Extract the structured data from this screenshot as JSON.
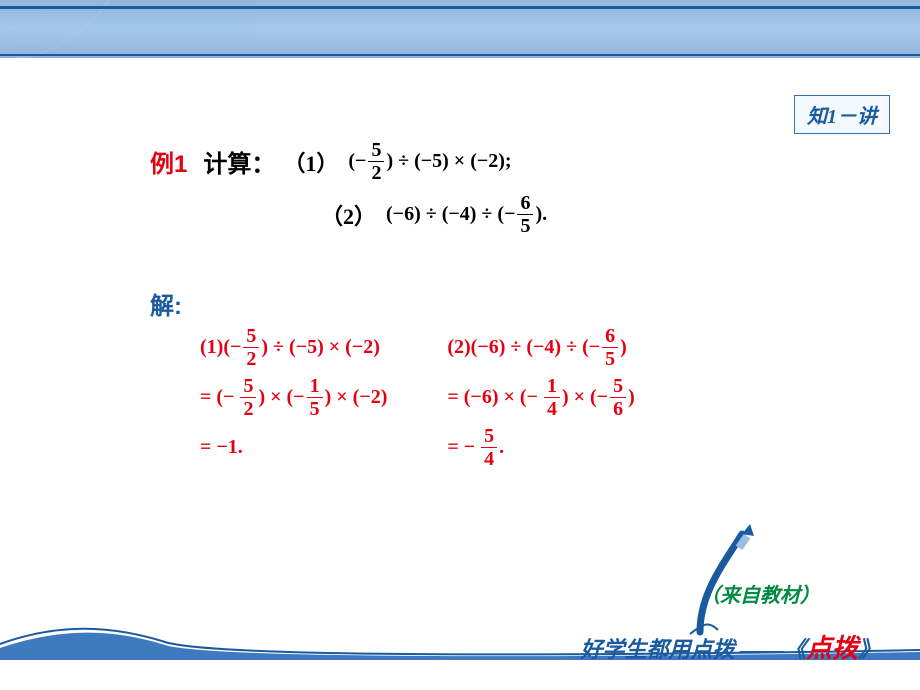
{
  "badge": "知1－讲",
  "example_label": "例1",
  "calc_label": "计算：",
  "item1_label": "（1）",
  "item2_label": "（2）",
  "solution_label": "解:",
  "source": "（来自教材）",
  "tagline_blue": "好学生都用点拨 ——《",
  "tagline_red": "点拨",
  "tagline_close": "》",
  "prob1": {
    "p1": "(−",
    "p2": "5",
    "p3": "2",
    "p4": ") ÷ (−5) × (−2);"
  },
  "prob2": {
    "p1": "(−6) ÷ (−4) ÷ (−",
    "p2": "6",
    "p3": "5",
    "p4": ")."
  },
  "sol1": {
    "l1a": "(1)(−",
    "l1n": "5",
    "l1d": "2",
    "l1b": ") ÷ (−5) × (−2)",
    "l2a": "= (−",
    "l2n1": "5",
    "l2d1": "2",
    "l2b": ") × (−",
    "l2n2": "1",
    "l2d2": "5",
    "l2c": ") × (−2)",
    "l3": "= −1."
  },
  "sol2": {
    "l1a": "(2)(−6) ÷ (−4) ÷ (−",
    "l1n": "6",
    "l1d": "5",
    "l1b": ")",
    "l2a": "= (−6) × (−",
    "l2n1": "1",
    "l2d1": "4",
    "l2b": ") × (−",
    "l2n2": "5",
    "l2d2": "6",
    "l2c": ")",
    "l3a": "= −",
    "l3n": "5",
    "l3d": "4",
    "l3b": "."
  }
}
